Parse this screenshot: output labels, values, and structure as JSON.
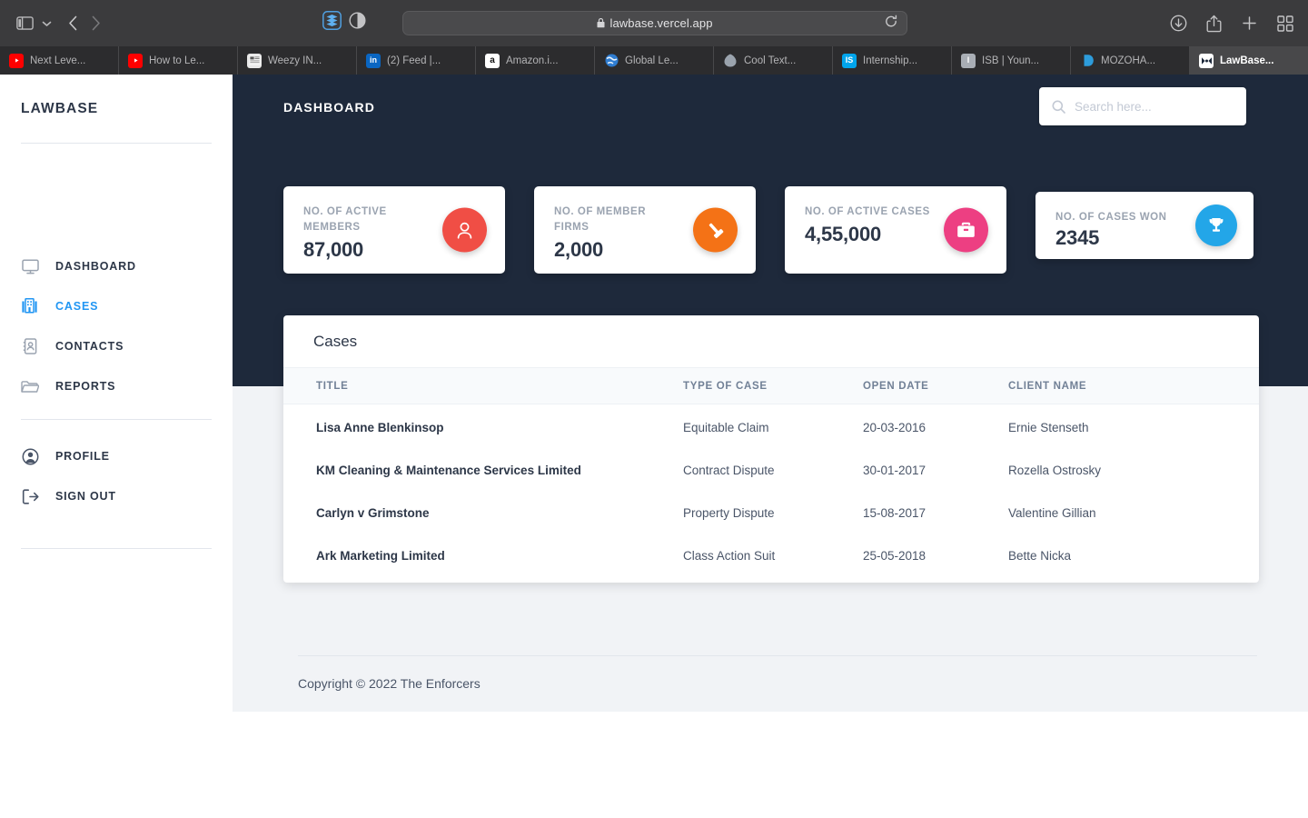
{
  "browser": {
    "url": "lawbase.vercel.app",
    "toolbar_left": [
      {
        "name": "sidebar-toggle",
        "icon": "sidebar-icon"
      },
      {
        "name": "tab-overview-chevron",
        "icon": "chevron-down-icon"
      },
      {
        "name": "back-button",
        "icon": "chevron-left-icon"
      },
      {
        "name": "forward-button",
        "icon": "chevron-right-icon"
      }
    ],
    "extensions": [
      {
        "name": "extension-stacks",
        "icon": "stacks-icon"
      },
      {
        "name": "reader-contrast",
        "icon": "contrast-icon"
      }
    ],
    "toolbar_right": [
      {
        "name": "downloads-button",
        "icon": "download-icon"
      },
      {
        "name": "share-button",
        "icon": "share-icon"
      },
      {
        "name": "new-tab-button",
        "icon": "plus-icon"
      },
      {
        "name": "tab-grid-button",
        "icon": "grid-icon"
      }
    ],
    "reload_icon": "reload-icon",
    "lock_icon": "lock-icon",
    "tabs": [
      {
        "label": "Next Leve...",
        "favicon": "youtube",
        "active": false
      },
      {
        "label": "How to Le...",
        "favicon": "youtube",
        "active": false
      },
      {
        "label": "Weezy IN...",
        "favicon": "news",
        "active": false
      },
      {
        "label": "(2) Feed |...",
        "favicon": "linkedin",
        "active": false
      },
      {
        "label": "Amazon.i...",
        "favicon": "amazon",
        "active": false
      },
      {
        "label": "Global Le...",
        "favicon": "globe",
        "active": false
      },
      {
        "label": "Cool Text...",
        "favicon": "blob",
        "active": false
      },
      {
        "label": "Internship...",
        "favicon": "internshala",
        "active": false
      },
      {
        "label": "ISB | Youn...",
        "favicon": "isb",
        "active": false
      },
      {
        "label": "MOZOHA...",
        "favicon": "mozo",
        "active": false
      },
      {
        "label": "LawBase...",
        "favicon": "lawbase",
        "active": true
      }
    ]
  },
  "sidebar": {
    "brand": "LAWBASE",
    "items": [
      {
        "label": "DASHBOARD",
        "icon": "monitor-icon",
        "active": false
      },
      {
        "label": "CASES",
        "icon": "building-icon",
        "active": true
      },
      {
        "label": "CONTACTS",
        "icon": "contact-book-icon",
        "active": false
      },
      {
        "label": "REPORTS",
        "icon": "folder-icon",
        "active": false
      },
      {
        "label": "PROFILE",
        "icon": "user-circle-icon",
        "active": false
      },
      {
        "label": "SIGN OUT",
        "icon": "sign-out-icon",
        "active": false
      }
    ]
  },
  "header": {
    "title": "DASHBOARD",
    "search_placeholder": "Search here...",
    "search_value": ""
  },
  "stats": [
    {
      "label": "NO. OF ACTIVE MEMBERS",
      "value": "87,000",
      "icon": "user-icon",
      "color": "#f04e45",
      "size": "tall"
    },
    {
      "label": "NO. OF MEMBER FIRMS",
      "value": "2,000",
      "icon": "gavel-icon",
      "color": "#f47216",
      "size": "tall"
    },
    {
      "label": "NO. OF ACTIVE CASES",
      "value": "4,55,000",
      "icon": "briefcase-icon",
      "color": "#ed3f82",
      "size": "tall"
    },
    {
      "label": "NO. OF CASES WON",
      "value": "2345",
      "icon": "trophy-icon",
      "color": "#23a6e8",
      "size": "short"
    }
  ],
  "cases": {
    "heading": "Cases",
    "columns": [
      "TITLE",
      "TYPE OF CASE",
      "OPEN DATE",
      "CLIENT NAME"
    ],
    "rows": [
      {
        "title": "Lisa Anne Blenkinsop",
        "type": "Equitable Claim",
        "date": "20-03-2016",
        "client": "Ernie Stenseth"
      },
      {
        "title": "KM Cleaning & Maintenance Services Limited",
        "type": "Contract Dispute",
        "date": "30-01-2017",
        "client": "Rozella Ostrosky"
      },
      {
        "title": "Carlyn v Grimstone",
        "type": "Property Dispute",
        "date": "15-08-2017",
        "client": "Valentine Gillian"
      },
      {
        "title": "Ark Marketing Limited",
        "type": "Class Action Suit",
        "date": "25-05-2018",
        "client": "Bette Nicka"
      }
    ]
  },
  "footer": {
    "copyright": "Copyright © 2022 The Enforcers"
  },
  "theme": {
    "hero_navy": "#1e293b",
    "page_gray": "#f1f3f6",
    "accent_blue": "#2196f3"
  }
}
